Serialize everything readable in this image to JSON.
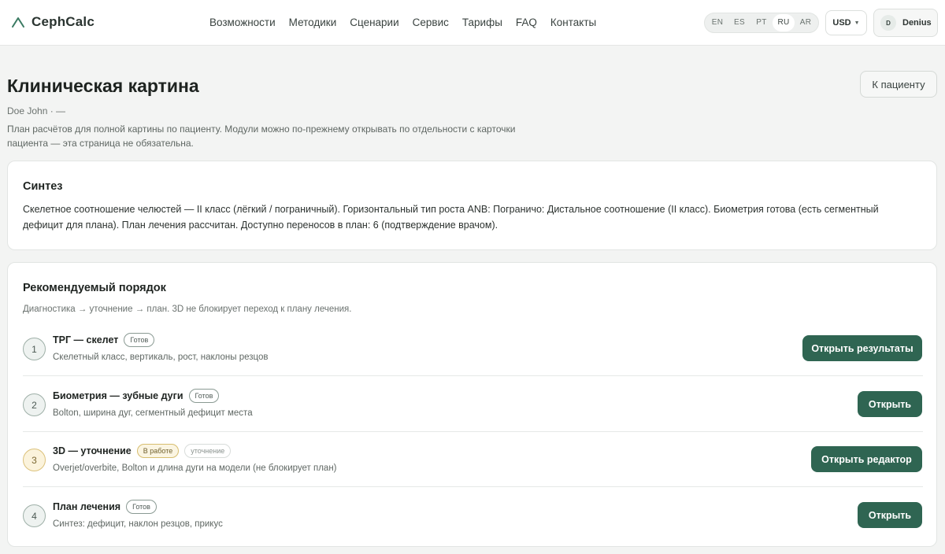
{
  "header": {
    "logo": "CephCalc",
    "nav": [
      "Возможности",
      "Методики",
      "Сценарии",
      "Сервис",
      "Тарифы",
      "FAQ",
      "Контакты"
    ],
    "languages": [
      "EN",
      "ES",
      "PT",
      "RU",
      "AR"
    ],
    "active_language": "RU",
    "currency": "USD",
    "user_initial": "D",
    "user_name": "Denius"
  },
  "page": {
    "title": "Клиническая картина",
    "patient": "Doe John · —",
    "description": "План расчётов для полной картины по пациенту. Модули можно по-прежнему открывать по отдельности с карточки пациента — эта страница не обязательна.",
    "to_patient_button": "К пациенту"
  },
  "synthesis": {
    "title": "Синтез",
    "text": "Скелетное соотношение челюстей — II класс (лёгкий / пограничный). Горизонтальный тип роста ANB: Пограничо: Дистальное соотношение (II класс). Биометрия готова (есть сегментный дефицит для плана). План лечения рассчитан. Доступно переносов в план: 6 (подтверждение врачом)."
  },
  "order": {
    "title": "Рекомендуемый порядок",
    "subtitle": "Диагностика → уточнение → план. 3D не блокирует переход к плану лечения.",
    "steps": [
      {
        "num": "1",
        "title": "ТРГ — скелет",
        "badge": "Готов",
        "desc": "Скелетный класс, вертикаль, рост, наклоны резцов",
        "button": "Открыть результаты"
      },
      {
        "num": "2",
        "title": "Биометрия — зубные дуги",
        "badge": "Готов",
        "desc": "Bolton, ширина дуг, сегментный дефицит места",
        "button": "Открыть"
      },
      {
        "num": "3",
        "title": "3D — уточнение",
        "badge": "В работе",
        "badge2": "уточнение",
        "desc": "Overjet/overbite, Bolton и длина дуги на модели (не блокирует план)",
        "button": "Открыть редактор"
      },
      {
        "num": "4",
        "title": "План лечения",
        "badge": "Готов",
        "desc": "Синтез: дефицит, наклон резцов, прикус",
        "button": "Открыть"
      }
    ]
  }
}
